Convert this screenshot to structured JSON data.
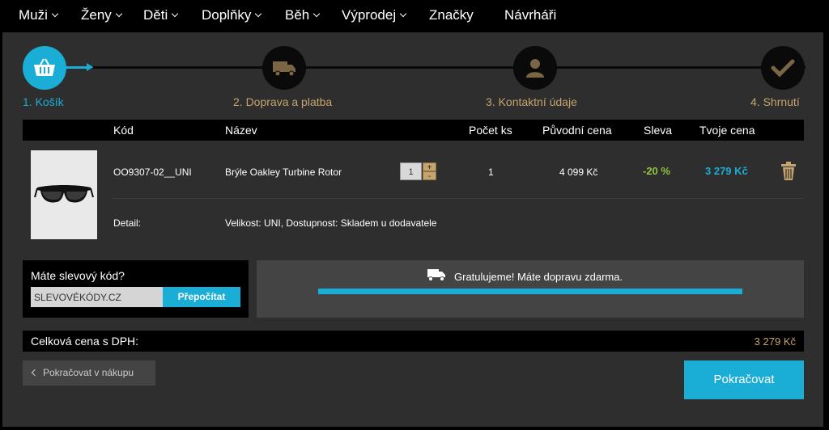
{
  "nav": {
    "items": [
      {
        "label": "Muži",
        "dropdown": true
      },
      {
        "label": "Ženy",
        "dropdown": true
      },
      {
        "label": "Děti",
        "dropdown": true
      },
      {
        "label": "Doplňky",
        "dropdown": true
      },
      {
        "label": "Běh",
        "dropdown": true
      },
      {
        "label": "Výprodej",
        "dropdown": true
      },
      {
        "label": "Značky",
        "dropdown": false
      },
      {
        "label": "Návrháři",
        "dropdown": false
      }
    ]
  },
  "steps": [
    {
      "label": "1. Košík",
      "icon": "basket-icon",
      "active": true
    },
    {
      "label": "2. Doprava a platba",
      "icon": "truck-icon",
      "active": false
    },
    {
      "label": "3. Kontaktní údaje",
      "icon": "user-icon",
      "active": false
    },
    {
      "label": "4. Shrnutí",
      "icon": "check-icon",
      "active": false
    }
  ],
  "table": {
    "headers": {
      "code": "Kód",
      "name": "Název",
      "qty": "Počet ks",
      "original_price": "Původní cena",
      "discount": "Sleva",
      "your_price": "Tvoje cena"
    },
    "item": {
      "code": "OO9307-02__UNI",
      "name": "Brýle Oakley Turbine Rotor",
      "qty_input": "1",
      "qty": "1",
      "original_price": "4 099 Kč",
      "discount": "-20 %",
      "your_price": "3 279 Kč",
      "detail_label": "Detail:",
      "detail_value": "Velikost: UNI, Dostupnost: Skladem u dodavatele"
    }
  },
  "discount": {
    "title": "Máte slevový kód?",
    "input_value": "SLEVOVÉKÓDY.CZ",
    "button": "Přepočítat"
  },
  "shipping": {
    "message": "Gratulujeme! Máte dopravu zdarma.",
    "progress": 1.0
  },
  "total": {
    "label": "Celková cena s DPH:",
    "value": "3 279 Kč"
  },
  "actions": {
    "back": "Pokračovat v nákupu",
    "continue": "Pokračovat"
  },
  "colors": {
    "accent": "#1aaed6",
    "gold": "#c5a46d",
    "discount_green": "#8fc63f"
  }
}
